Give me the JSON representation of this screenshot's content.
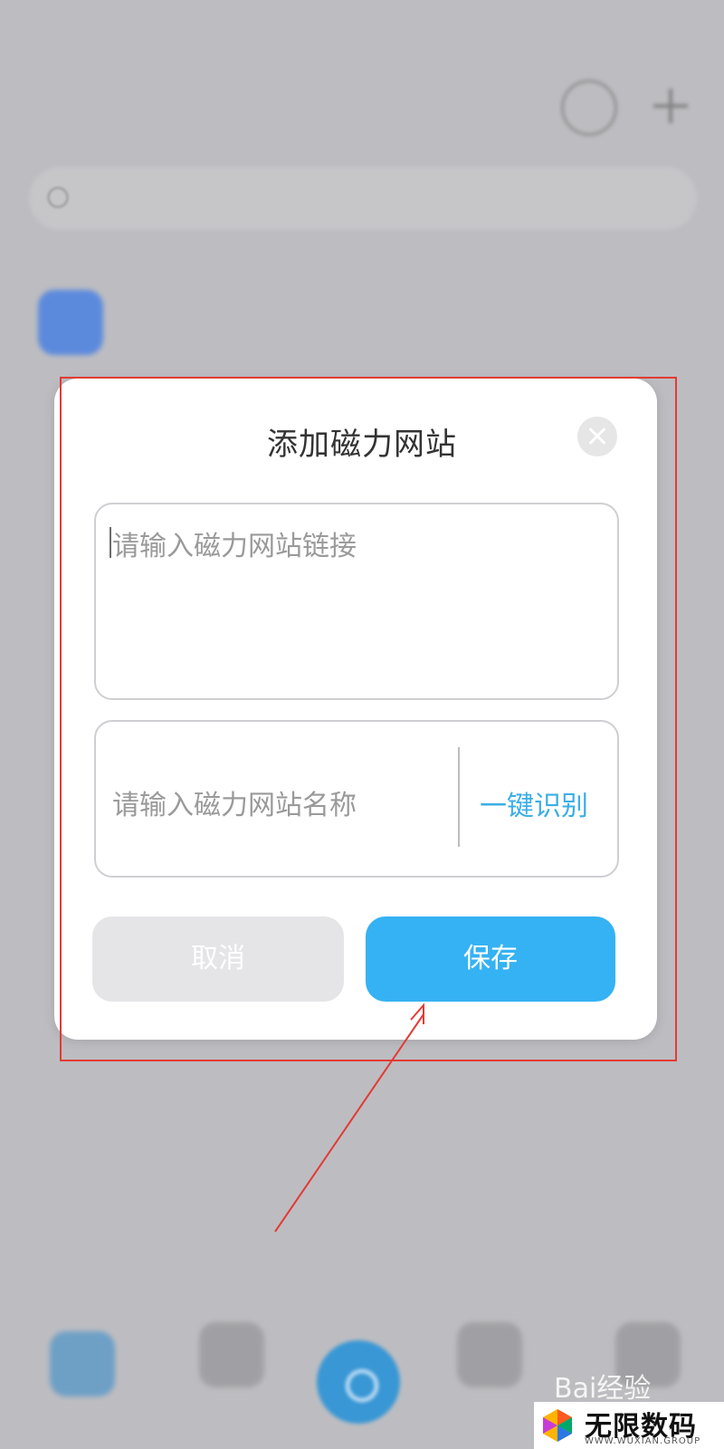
{
  "background": {
    "status_bar": {
      "left": "",
      "center": "",
      "right": ""
    },
    "header_title": "",
    "search_placeholder": "",
    "list_item": {
      "title": "",
      "url": ""
    }
  },
  "modal": {
    "title": "添加磁力网站",
    "link_input": {
      "placeholder": "请输入磁力网站链接",
      "value": ""
    },
    "name_input": {
      "placeholder": "请输入磁力网站名称",
      "value": ""
    },
    "recognize_label": "一键识别",
    "cancel_label": "取消",
    "save_label": "保存"
  },
  "watermark": {
    "baidu_text": "Bai经验",
    "brand_text": "无限数码",
    "brand_sub": "WWW.WUXIAN.GROUP"
  },
  "colors": {
    "save_button": "#35b2f3",
    "recognize_link": "#3baee6",
    "annotation_red": "#e33a35",
    "background_blur": "#bdbdc1"
  }
}
